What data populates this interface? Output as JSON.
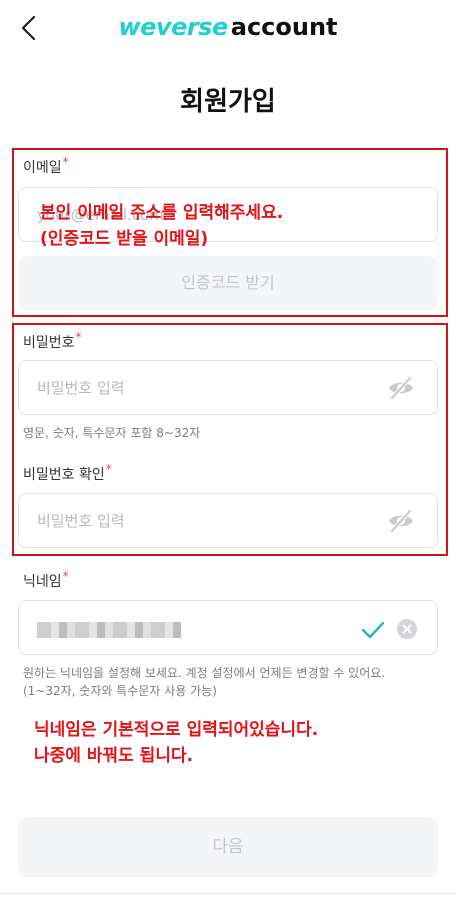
{
  "header": {
    "brand": "weverse",
    "account": "account"
  },
  "page_title": "회원가입",
  "email": {
    "label": "이메일",
    "required": "*",
    "placeholder": "your@email.com",
    "verify_button": "인증코드 받기"
  },
  "password": {
    "label": "비밀번호",
    "required": "*",
    "placeholder": "비밀번호 입력",
    "hint": "영문, 숫자, 특수문자 포함 8~32자"
  },
  "password_confirm": {
    "label": "비밀번호 확인",
    "required": "*",
    "placeholder": "비밀번호 입력"
  },
  "nickname": {
    "label": "닉네임",
    "required": "*",
    "hint_line1": "원하는 닉네임을 설정해 보세요. 계정 설정에서 언제든 변경할 수 있어요.",
    "hint_line2": "(1~32자, 숫자와 특수문자 사용 가능)"
  },
  "annotations": {
    "email_line1": "본인 이메일 주소를 입력해주세요.",
    "email_line2": "(인증코드 받을 이메일)",
    "nickname_line1": "닉네임은 기본적으로 입력되어있습니다.",
    "nickname_line2": "나중에 바꿔도 됩니다."
  },
  "next_button": "다음",
  "colors": {
    "brand": "#1fcfd1",
    "annotation_red": "#d3151b",
    "check": "#1fb6c1",
    "required": "#f0356a"
  },
  "icons": {
    "back": "chevron-left-icon",
    "eye_hidden": "eye-off-icon",
    "check": "check-icon",
    "clear": "clear-icon"
  }
}
